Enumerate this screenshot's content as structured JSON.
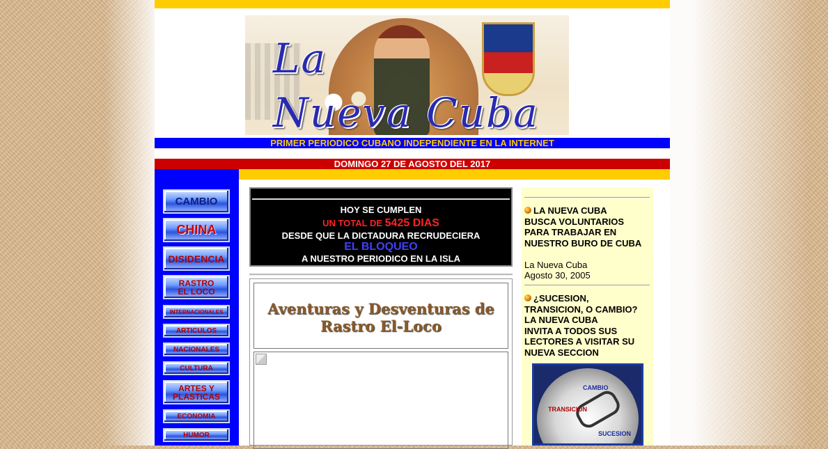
{
  "masthead": {
    "title_line1": "La",
    "title_line2": "Nueva Cuba"
  },
  "tagline": "PRIMER PERIODICO CUBANO INDEPENDIENTE EN LA INTERNET",
  "dateline": "DOMINGO 27 DE AGOSTO DEL 2017",
  "nav": {
    "items": [
      {
        "label": "CAMBIO"
      },
      {
        "label": "CHINA"
      },
      {
        "label": "DISIDENCIA"
      },
      {
        "label": "RASTRO EL LOCO"
      },
      {
        "label": "INTERNACIONALES"
      },
      {
        "label": "ARTICULOS"
      },
      {
        "label": "NACIONALES"
      },
      {
        "label": "CULTURA"
      },
      {
        "label": "ARTES Y PLASTICAS"
      },
      {
        "label": "ECONOMIA"
      },
      {
        "label": "HUMOR"
      }
    ]
  },
  "counter": {
    "line1": "HOY SE CUMPLEN",
    "line2_prefix": "UN TOTAL DE",
    "line2_days": "5425 DIAS",
    "line3": "DESDE QUE LA DICTADURA RECRUDECIERA",
    "line4": "EL BLOQUEO",
    "line5": "A NUESTRO PERIODICO EN LA ISLA"
  },
  "article": {
    "title_line1": "Aventuras y Desventuras de",
    "title_line2": "Rastro El-Loco"
  },
  "right_column": {
    "item1_headline_1": "LA NUEVA CUBA",
    "item1_headline_2": "BUSCA VOLUNTARIOS",
    "item1_headline_3": "PARA TRABAJAR EN",
    "item1_headline_4": "NUESTRO BURO DE CUBA",
    "item1_source": "La Nueva Cuba",
    "item1_date": "Agosto 30, 2005",
    "item2_headline_1": "¿SUCESION,",
    "item2_headline_2": "TRANSICION, O CAMBIO?",
    "item2_headline_3": "LA NUEVA CUBA",
    "item2_headline_4": "INVITA A TODOS SUS",
    "item2_headline_5": "LECTORES A VISITAR SU",
    "item2_headline_6": "NUEVA SECCION",
    "promo_labels": {
      "cambio": "CAMBIO",
      "transicion": "TRANSICION",
      "sucesion": "SUCESION"
    }
  },
  "colors": {
    "blue": "#0000ff",
    "yellow": "#ffcc00",
    "red": "#cc0000",
    "right_column_bg": "#ffffcc"
  }
}
